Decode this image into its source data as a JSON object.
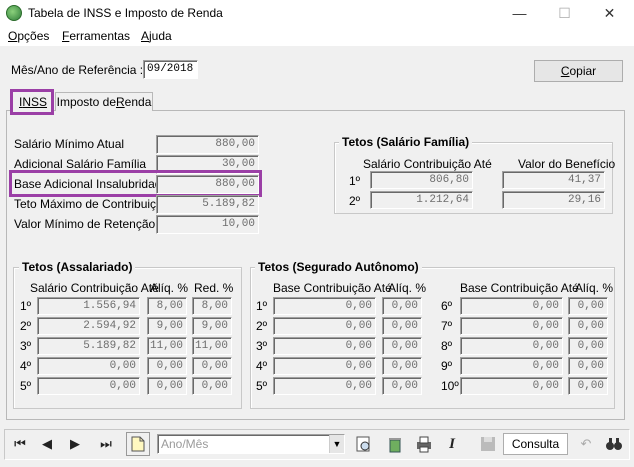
{
  "window": {
    "title": "Tabela de INSS e Imposto de Renda",
    "minimize": "—",
    "maximize": "☐",
    "close": "✕"
  },
  "menu": [
    {
      "label": "Opções",
      "u": "O",
      "rest": "pções"
    },
    {
      "label": "Ferramentas",
      "u": "F",
      "rest": "erramentas"
    },
    {
      "label": "Ajuda",
      "u": "A",
      "rest": "juda"
    }
  ],
  "header": {
    "ref_label": "Mês/Ano de Referência :",
    "ref_value": "09/2018",
    "copy_button": "Copiar",
    "copy_u": "C",
    "copy_rest": "opiar"
  },
  "tabs": [
    {
      "label": "INSS",
      "u": "I",
      "rest": "NSS"
    },
    {
      "label": "Imposto de Renda",
      "pre": "Imposto de ",
      "u": "R",
      "rest": "enda"
    }
  ],
  "inss": {
    "fields": [
      {
        "label": "Salário Mínimo Atual",
        "value": "880,00"
      },
      {
        "label": "Adicional Salário Família",
        "value": "30,00"
      },
      {
        "label": "Base Adicional Insalubridade",
        "value": "880,00"
      },
      {
        "label": "Teto Máximo de Contribuição",
        "value": "5.189,82"
      },
      {
        "label": "Valor Mínimo de Retenção",
        "value": "10,00"
      }
    ],
    "salario_familia": {
      "title": "Tetos (Salário Família)",
      "col1": "Salário Contribuição Até",
      "col2": "Valor do Benefício",
      "rows": [
        {
          "n": "1º",
          "contrib": "806,80",
          "benef": "41,37"
        },
        {
          "n": "2º",
          "contrib": "1.212,64",
          "benef": "29,16"
        }
      ]
    },
    "assalariado": {
      "title": "Tetos (Assalariado)",
      "col1": "Salário Contribuição Até",
      "col2": "Alíq. %",
      "col3": "Red. %",
      "rows": [
        {
          "n": "1º",
          "contrib": "1.556,94",
          "aliq": "8,00",
          "red": "8,00"
        },
        {
          "n": "2º",
          "contrib": "2.594,92",
          "aliq": "9,00",
          "red": "9,00"
        },
        {
          "n": "3º",
          "contrib": "5.189,82",
          "aliq": "11,00",
          "red": "11,00"
        },
        {
          "n": "4º",
          "contrib": "0,00",
          "aliq": "0,00",
          "red": "0,00"
        },
        {
          "n": "5º",
          "contrib": "0,00",
          "aliq": "0,00",
          "red": "0,00"
        }
      ]
    },
    "autonomo": {
      "title": "Tetos (Segurado Autônomo)",
      "col1": "Base Contribuição Até",
      "col2": "Alíq. %",
      "left": [
        {
          "n": "1º",
          "base": "0,00",
          "aliq": "0,00"
        },
        {
          "n": "2º",
          "base": "0,00",
          "aliq": "0,00"
        },
        {
          "n": "3º",
          "base": "0,00",
          "aliq": "0,00"
        },
        {
          "n": "4º",
          "base": "0,00",
          "aliq": "0,00"
        },
        {
          "n": "5º",
          "base": "0,00",
          "aliq": "0,00"
        }
      ],
      "right": [
        {
          "n": "6º",
          "base": "0,00",
          "aliq": "0,00"
        },
        {
          "n": "7º",
          "base": "0,00",
          "aliq": "0,00"
        },
        {
          "n": "8º",
          "base": "0,00",
          "aliq": "0,00"
        },
        {
          "n": "9º",
          "base": "0,00",
          "aliq": "0,00"
        },
        {
          "n": "10º",
          "base": "0,00",
          "aliq": "0,00"
        }
      ]
    }
  },
  "toolbar": {
    "first": "⏮",
    "prev": "◀",
    "next": "▶",
    "last": "⏭",
    "new_icon": "new-document-icon",
    "combo_placeholder": "Ano/Mês",
    "query_button": "Consulta"
  },
  "colors": {
    "highlight": "#9b3fa6",
    "field_text": "#6d6d6d"
  }
}
